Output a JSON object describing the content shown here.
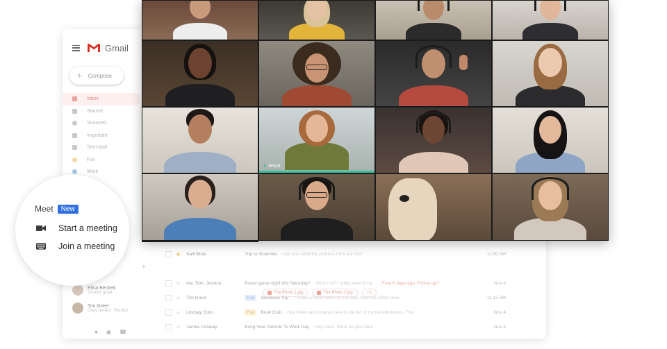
{
  "gmail": {
    "app_name": "Gmail",
    "compose_label": "Compose",
    "nav": [
      {
        "label": "Inbox",
        "icon": "inbox-icon",
        "active": true
      },
      {
        "label": "Starred",
        "icon": "star-icon",
        "active": false
      },
      {
        "label": "Snoozed",
        "icon": "clock-icon",
        "active": false
      },
      {
        "label": "Important",
        "icon": "important-icon",
        "active": false
      },
      {
        "label": "Sent Mail",
        "icon": "send-icon",
        "active": false
      },
      {
        "label": "Fun",
        "icon": "label-icon",
        "active": false
      },
      {
        "label": "Work",
        "icon": "label-icon",
        "active": false
      }
    ],
    "contacts": [
      {
        "name": "Elisa Beckett",
        "status": "Sounds great"
      },
      {
        "name": "Tim Greer",
        "status": "Okay perfect. Thanks!"
      }
    ],
    "emails": [
      {
        "from": "Salil Bulla",
        "tag": "",
        "subject": "Trip to Yosemite",
        "snippet": "- Can you send the pictures from our trip?",
        "extra": "",
        "time": "11:30 AM"
      },
      {
        "from": "",
        "tag": "",
        "subject": "",
        "snippet": "",
        "extra": "",
        "time": ""
      },
      {
        "from": "me, Tom, Jessica",
        "tag": "",
        "subject": "Board game night this Saturday?",
        "snippet": "- Who's in? I really want to try",
        "extra": "Free 6 days ago. Follow up?",
        "time": "Nov 4"
      },
      {
        "from": "Tim Greer",
        "tag": "Fun",
        "subject": "Weekend Trip",
        "snippet": "- I made a reservation for the lake near the office Give",
        "extra": "",
        "time": "11:15 AM"
      },
      {
        "from": "Lindsay Coro",
        "tag": "Fun",
        "subject": "Book Club",
        "snippet": "- Hey Peter and Ananya here is the list of my favorite books. The",
        "extra": "",
        "time": "Nov 4"
      },
      {
        "from": "James Conway",
        "tag": "",
        "subject": "Bring Your Parents To Work Day",
        "snippet": "- Hey team. What do you think",
        "extra": "",
        "time": "Nov 4"
      }
    ],
    "attachments": [
      "The Photo 1.jpg",
      "The Photo 2.jpg",
      "+1"
    ]
  },
  "meet": {
    "title": "Meet",
    "badge": "New",
    "options": [
      {
        "label": "Start a meeting",
        "icon": "video-camera-icon"
      },
      {
        "label": "Join a meeting",
        "icon": "keyboard-icon"
      }
    ]
  },
  "video_call": {
    "speaking_participant": "Jesse",
    "participant_count": 16
  },
  "colors": {
    "meet_badge": "#2f6fe2",
    "gmail_red": "#d93025",
    "speaking_indicator": "#3bbf9d",
    "inbox_active": "#fdf0ef"
  }
}
